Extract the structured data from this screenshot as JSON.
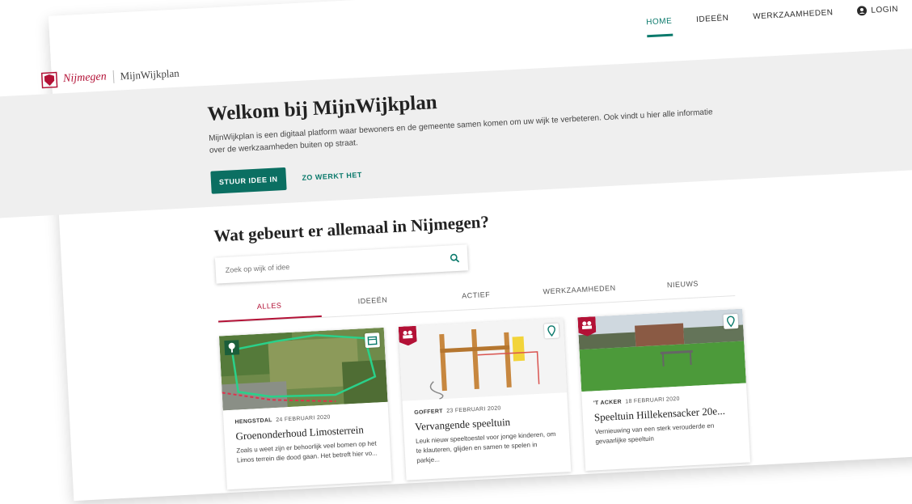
{
  "header": {
    "brand_name": "Nijmegen",
    "app_name": "MijnWijkplan",
    "nav": {
      "home": "HOME",
      "ideas": "IDEEËN",
      "works": "WERKZAAMHEDEN",
      "login": "LOGIN"
    }
  },
  "hero": {
    "title": "Welkom bij MijnWijkplan",
    "text": "MijnWijkplan is een digitaal platform waar bewoners en de gemeente samen komen om uw wijk te verbeteren. Ook vindt u hier alle informatie over de werkzaamheden buiten op straat.",
    "primary_button": "STUUR IDEE IN",
    "secondary_link": "ZO WERKT HET"
  },
  "main": {
    "title": "Wat gebeurt er allemaal in Nijmegen?",
    "search_placeholder": "Zoek op wijk of idee",
    "tabs": [
      "ALLES",
      "IDEEËN",
      "ACTIEF",
      "WERKZAAMHEDEN",
      "NIEUWS"
    ],
    "cards": [
      {
        "place": "HENGSTDAL",
        "date": "24 FEBRUARI 2020",
        "title": "Groenonderhoud Limosterrein",
        "text": "Zoals u weet zijn er behoorlijk veel bomen op het Limos terrein die dood gaan. Het betreft hier vo..."
      },
      {
        "place": "GOFFERT",
        "date": "23 FEBRUARI 2020",
        "title": "Vervangende speeltuin",
        "text": "Leuk nieuw speeltoestel voor jonge kinderen, om te klauteren, glijden en samen te spelen in parkje..."
      },
      {
        "place": "'T ACKER",
        "date": "18 FEBRUARI 2020",
        "title": "Speeltuin Hillekensacker 20e...",
        "text": "Vernieuwing van een sterk verouderde en gevaarlijke speeltuin"
      }
    ]
  },
  "icons": {
    "brand": "nijmegen-logo",
    "login": "user-icon",
    "search": "search-icon",
    "card_badges": [
      "tree-icon",
      "group-icon",
      "group-icon"
    ],
    "card_actions": [
      "calendar-icon",
      "location-pin-icon",
      "location-pin-icon"
    ],
    "fab": "plus-icon"
  },
  "colors": {
    "brand_red": "#b31136",
    "accent_green": "#0b7a6c",
    "fab": "#c31238"
  }
}
